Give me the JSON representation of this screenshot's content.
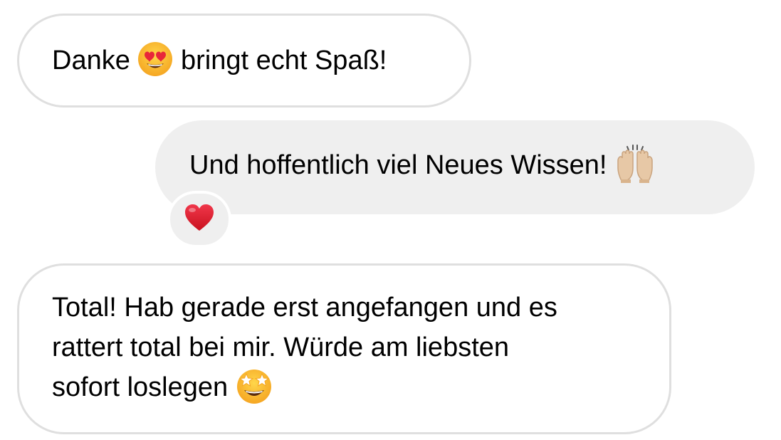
{
  "messages": [
    {
      "direction": "incoming",
      "text_before": "Danke",
      "emoji": "smiling-face-with-heart-eyes-icon",
      "text_after": "bringt echt Spaß!"
    },
    {
      "direction": "outgoing",
      "text": "Und hoffentlich viel Neues Wissen!",
      "emoji": "raising-hands-icon",
      "reaction": "red-heart-icon"
    },
    {
      "direction": "incoming",
      "lines": [
        "Total! Hab gerade erst angefangen und es",
        "rattert total bei mir. Würde am liebsten",
        "sofort loslegen"
      ],
      "emoji": "star-struck-icon"
    }
  ],
  "colors": {
    "incoming_bubble_bg": "#ffffff",
    "incoming_bubble_border": "#dfdfdf",
    "outgoing_bubble_bg": "#efefef",
    "text": "#000000",
    "heart": "#e0212f"
  }
}
